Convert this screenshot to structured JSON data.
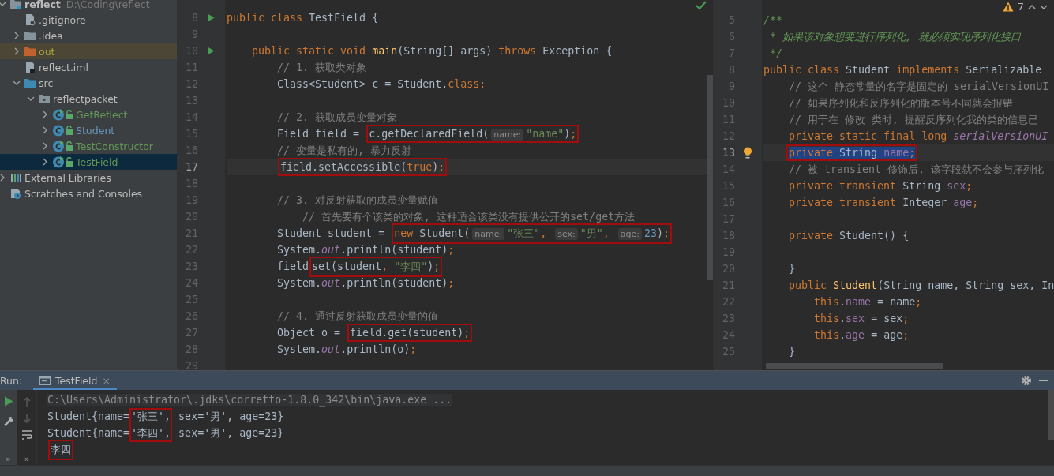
{
  "tree": [
    {
      "kind": "project",
      "name": "reflect",
      "path": "D:\\Coding\\reflect",
      "expanded": true,
      "selected": false,
      "children": [
        {
          "kind": "ignore-file",
          "name": ".gitignore",
          "selected": false
        },
        {
          "kind": "folder",
          "name": ".idea",
          "expanded": false,
          "selected": false
        },
        {
          "kind": "excluded-folder",
          "name": "out",
          "expanded": false,
          "selected": false
        },
        {
          "kind": "module-file",
          "name": "reflect.iml",
          "selected": false
        },
        {
          "kind": "source-folder",
          "name": "src",
          "expanded": true,
          "selected": false,
          "children": [
            {
              "kind": "package",
              "name": "reflectpacket",
              "expanded": true,
              "selected": false,
              "children": [
                {
                  "kind": "runnable-class",
                  "name": "GetReflect",
                  "color": "#629755",
                  "expanded": false,
                  "selected": false
                },
                {
                  "kind": "class",
                  "name": "Student",
                  "color": "#6897bb",
                  "expanded": false,
                  "selected": false
                },
                {
                  "kind": "runnable-class",
                  "name": "TestConstructor",
                  "color": "#629755",
                  "expanded": false,
                  "selected": false
                },
                {
                  "kind": "runnable-class",
                  "name": "TestField",
                  "color": "#629755",
                  "expanded": false,
                  "selected": true
                }
              ]
            }
          ]
        }
      ]
    },
    {
      "kind": "libraries",
      "name": "External Libraries",
      "expanded": false,
      "selected": false
    },
    {
      "kind": "scratches",
      "name": "Scratches and Consoles",
      "selected": false
    }
  ],
  "editors": [
    {
      "inspection": {
        "kind": "ok"
      },
      "lines": [
        {
          "num": "8",
          "current": false,
          "gutter": {
            "kind": "run"
          },
          "segments": [
            {
              "kind": "code",
              "tokens": [
                {
                  "text": "public class ",
                  "kind": "kw"
                },
                {
                  "text": "TestField {",
                  "kind": "plain"
                }
              ]
            }
          ]
        },
        {
          "num": "9",
          "current": false
        },
        {
          "num": "10",
          "current": false,
          "gutter": {
            "kind": "run"
          },
          "segments": [
            {
              "kind": "code",
              "tokens": [
                {
                  "text": "    public static void ",
                  "kind": "kw"
                },
                {
                  "text": "main",
                  "kind": "method"
                },
                {
                  "text": "(String[] args) ",
                  "kind": "plain"
                },
                {
                  "text": "throws ",
                  "kind": "kw"
                },
                {
                  "text": "Exception {",
                  "kind": "plain"
                }
              ]
            }
          ]
        },
        {
          "num": "11",
          "current": false,
          "segments": [
            {
              "kind": "code",
              "tokens": [
                {
                  "text": "        // 1. 获取类对象",
                  "kind": "comment"
                }
              ]
            }
          ]
        },
        {
          "num": "12",
          "current": false,
          "segments": [
            {
              "kind": "code",
              "tokens": [
                {
                  "text": "        Class<Student> c = Student.",
                  "kind": "plain"
                },
                {
                  "text": "class;",
                  "kind": "kw"
                }
              ]
            }
          ]
        },
        {
          "num": "13",
          "current": false
        },
        {
          "num": "14",
          "current": false,
          "segments": [
            {
              "kind": "code",
              "tokens": [
                {
                  "text": "        // 2. 获取成员变量对象",
                  "kind": "comment"
                }
              ]
            }
          ]
        },
        {
          "num": "15",
          "current": false,
          "segments": [
            {
              "kind": "code",
              "tokens": [
                {
                  "text": "        Field field = ",
                  "kind": "plain"
                }
              ]
            },
            {
              "kind": "box",
              "tokens": [
                {
                  "text": "c.getDeclaredField(",
                  "kind": "plain"
                },
                {
                  "text": "name:",
                  "kind": "hint"
                },
                {
                  "text": "\"name\"",
                  "kind": "str"
                },
                {
                  "text": ")",
                  "kind": "plain"
                },
                {
                  "text": ";",
                  "kind": "kw"
                }
              ]
            }
          ]
        },
        {
          "num": "16",
          "current": false,
          "segments": [
            {
              "kind": "code",
              "tokens": [
                {
                  "text": "        // 变量是私有的, 暴力反射",
                  "kind": "comment"
                }
              ]
            }
          ]
        },
        {
          "num": "17",
          "current": true,
          "segments": [
            {
              "kind": "box",
              "tokens": [
                {
                  "text": "        field.setAccessible(",
                  "kind": "plain"
                },
                {
                  "text": "true",
                  "kind": "kw"
                },
                {
                  "text": ")",
                  "kind": "plain"
                },
                {
                  "text": ";",
                  "kind": "kw"
                }
              ]
            }
          ]
        },
        {
          "num": "18",
          "current": false
        },
        {
          "num": "19",
          "current": false,
          "segments": [
            {
              "kind": "code",
              "tokens": [
                {
                  "text": "        // 3. 对反射获取的成员变量赋值",
                  "kind": "comment"
                }
              ]
            }
          ]
        },
        {
          "num": "20",
          "current": false,
          "segments": [
            {
              "kind": "code",
              "tokens": [
                {
                  "text": "            // 首先要有个该类的对象, 这种适合该类没有提供公开的set/get方法",
                  "kind": "comment"
                }
              ]
            }
          ]
        },
        {
          "num": "21",
          "current": false,
          "segments": [
            {
              "kind": "code",
              "tokens": [
                {
                  "text": "        Student student = ",
                  "kind": "plain"
                }
              ]
            },
            {
              "kind": "box",
              "tokens": [
                {
                  "text": "new ",
                  "kind": "kw"
                },
                {
                  "text": "Student(",
                  "kind": "plain"
                },
                {
                  "text": "name:",
                  "kind": "hint"
                },
                {
                  "text": "\"张三\"",
                  "kind": "str"
                },
                {
                  "text": ", ",
                  "kind": "kw"
                },
                {
                  "text": "sex:",
                  "kind": "hint"
                },
                {
                  "text": "\"男\"",
                  "kind": "str"
                },
                {
                  "text": ", ",
                  "kind": "kw"
                },
                {
                  "text": "age:",
                  "kind": "hint"
                },
                {
                  "text": "23",
                  "kind": "num"
                },
                {
                  "text": ")",
                  "kind": "plain"
                },
                {
                  "text": ";",
                  "kind": "kw"
                }
              ]
            }
          ]
        },
        {
          "num": "22",
          "current": false,
          "segments": [
            {
              "kind": "code",
              "tokens": [
                {
                  "text": "        System.",
                  "kind": "plain"
                },
                {
                  "text": "out",
                  "kind": "static"
                },
                {
                  "text": ".println(student)",
                  "kind": "plain"
                },
                {
                  "text": ";",
                  "kind": "kw"
                }
              ]
            }
          ]
        },
        {
          "num": "23",
          "current": false,
          "segments": [
            {
              "kind": "code",
              "tokens": [
                {
                  "text": "        field",
                  "kind": "plain"
                }
              ]
            },
            {
              "kind": "box",
              "tokens": [
                {
                  "text": "set(student",
                  "kind": "plain"
                },
                {
                  "text": ", ",
                  "kind": "kw"
                },
                {
                  "text": "\"李四\"",
                  "kind": "str"
                },
                {
                  "text": ")",
                  "kind": "plain"
                },
                {
                  "text": ";",
                  "kind": "kw"
                }
              ]
            }
          ]
        },
        {
          "num": "24",
          "current": false,
          "segments": [
            {
              "kind": "code",
              "tokens": [
                {
                  "text": "        System.",
                  "kind": "plain"
                },
                {
                  "text": "out",
                  "kind": "static"
                },
                {
                  "text": ".println(student)",
                  "kind": "plain"
                },
                {
                  "text": ";",
                  "kind": "kw"
                }
              ]
            }
          ]
        },
        {
          "num": "25",
          "current": false
        },
        {
          "num": "26",
          "current": false,
          "segments": [
            {
              "kind": "code",
              "tokens": [
                {
                  "text": "        // 4. 通过反射获取成员变量的值",
                  "kind": "comment"
                }
              ]
            }
          ]
        },
        {
          "num": "27",
          "current": false,
          "segments": [
            {
              "kind": "code",
              "tokens": [
                {
                  "text": "        Object o = ",
                  "kind": "plain"
                }
              ]
            },
            {
              "kind": "box",
              "tokens": [
                {
                  "text": "field.get(student)",
                  "kind": "plain"
                },
                {
                  "text": ";",
                  "kind": "kw"
                }
              ]
            }
          ]
        },
        {
          "num": "28",
          "current": false,
          "segments": [
            {
              "kind": "code",
              "tokens": [
                {
                  "text": "        System.",
                  "kind": "plain"
                },
                {
                  "text": "out",
                  "kind": "static"
                },
                {
                  "text": ".println(o)",
                  "kind": "plain"
                },
                {
                  "text": ";",
                  "kind": "kw"
                }
              ]
            }
          ]
        },
        {
          "num": "29",
          "current": false
        }
      ]
    },
    {
      "inspection": {
        "kind": "warnings",
        "count": "7"
      },
      "lines": [
        {
          "num": "5",
          "current": false,
          "segments": [
            {
              "kind": "code",
              "tokens": [
                {
                  "text": "/**",
                  "kind": "doc"
                }
              ]
            }
          ]
        },
        {
          "num": "6",
          "current": false,
          "segments": [
            {
              "kind": "code",
              "tokens": [
                {
                  "text": " * 如果该对象想要进行序列化, 就必须实现序列化接口",
                  "kind": "doc"
                }
              ]
            }
          ]
        },
        {
          "num": "7",
          "current": false,
          "segments": [
            {
              "kind": "code",
              "tokens": [
                {
                  "text": " */",
                  "kind": "doc"
                }
              ]
            }
          ]
        },
        {
          "num": "8",
          "current": false,
          "segments": [
            {
              "kind": "code",
              "tokens": [
                {
                  "text": "public class ",
                  "kind": "kw"
                },
                {
                  "text": "Student ",
                  "kind": "plain"
                },
                {
                  "text": "implements ",
                  "kind": "kw"
                },
                {
                  "text": "Serializable",
                  "kind": "plain"
                }
              ]
            }
          ]
        },
        {
          "num": "9",
          "current": false,
          "segments": [
            {
              "kind": "code",
              "tokens": [
                {
                  "text": "    // 这个 静态常量的名字是固定的 serialVersionUI",
                  "kind": "comment"
                }
              ]
            }
          ]
        },
        {
          "num": "10",
          "current": false,
          "segments": [
            {
              "kind": "code",
              "tokens": [
                {
                  "text": "    // 如果序列化和反序列化的版本号不同就会报错",
                  "kind": "comment"
                }
              ]
            }
          ]
        },
        {
          "num": "11",
          "current": false,
          "segments": [
            {
              "kind": "code",
              "tokens": [
                {
                  "text": "    // 用于在 修改 类时, 提醒反序列化我的类的信息已",
                  "kind": "comment"
                }
              ]
            }
          ]
        },
        {
          "num": "12",
          "current": false,
          "segments": [
            {
              "kind": "code",
              "tokens": [
                {
                  "text": "    private static final long ",
                  "kind": "kw"
                },
                {
                  "text": "serialVersionUI",
                  "kind": "static"
                }
              ]
            }
          ]
        },
        {
          "num": "13",
          "current": true,
          "gutter": {
            "kind": "bulb"
          },
          "segments": [
            {
              "kind": "selected-box",
              "tokens": [
                {
                  "text": "    private ",
                  "kind": "kw"
                },
                {
                  "text": "String ",
                  "kind": "plain"
                },
                {
                  "text": "name",
                  "kind": "field"
                },
                {
                  "text": ";",
                  "kind": "kw"
                }
              ]
            }
          ]
        },
        {
          "num": "14",
          "current": false,
          "segments": [
            {
              "kind": "code",
              "tokens": [
                {
                  "text": "    // 被 transient 修饰后, 该字段就不会参与序列化",
                  "kind": "comment"
                }
              ]
            }
          ]
        },
        {
          "num": "15",
          "current": false,
          "segments": [
            {
              "kind": "code",
              "tokens": [
                {
                  "text": "    private transient ",
                  "kind": "kw"
                },
                {
                  "text": "String ",
                  "kind": "plain"
                },
                {
                  "text": "sex",
                  "kind": "field"
                },
                {
                  "text": ";",
                  "kind": "kw"
                }
              ]
            }
          ]
        },
        {
          "num": "16",
          "current": false,
          "segments": [
            {
              "kind": "code",
              "tokens": [
                {
                  "text": "    private transient ",
                  "kind": "kw"
                },
                {
                  "text": "Integer ",
                  "kind": "plain"
                },
                {
                  "text": "age",
                  "kind": "field"
                },
                {
                  "text": ";",
                  "kind": "kw"
                }
              ]
            }
          ]
        },
        {
          "num": "17",
          "current": false
        },
        {
          "num": "18",
          "current": false,
          "segments": [
            {
              "kind": "code",
              "tokens": [
                {
                  "text": "    private ",
                  "kind": "kw"
                },
                {
                  "text": "Student() {",
                  "kind": "plain"
                }
              ]
            }
          ]
        },
        {
          "num": "19",
          "current": false
        },
        {
          "num": "20",
          "current": false,
          "segments": [
            {
              "kind": "code",
              "tokens": [
                {
                  "text": "    }",
                  "kind": "plain"
                }
              ]
            }
          ]
        },
        {
          "num": "21",
          "current": false,
          "segments": [
            {
              "kind": "code",
              "tokens": [
                {
                  "text": "    public ",
                  "kind": "kw"
                },
                {
                  "text": "Student",
                  "kind": "method"
                },
                {
                  "text": "(String name, String sex, In",
                  "kind": "plain"
                }
              ]
            }
          ]
        },
        {
          "num": "22",
          "current": false,
          "segments": [
            {
              "kind": "code",
              "tokens": [
                {
                  "text": "        this",
                  "kind": "kw"
                },
                {
                  "text": ".",
                  "kind": "plain"
                },
                {
                  "text": "name",
                  "kind": "field"
                },
                {
                  "text": " = name",
                  "kind": "plain"
                },
                {
                  "text": ";",
                  "kind": "kw"
                }
              ]
            }
          ]
        },
        {
          "num": "23",
          "current": false,
          "segments": [
            {
              "kind": "code",
              "tokens": [
                {
                  "text": "        this",
                  "kind": "kw"
                },
                {
                  "text": ".",
                  "kind": "plain"
                },
                {
                  "text": "sex",
                  "kind": "field"
                },
                {
                  "text": " = sex",
                  "kind": "plain"
                },
                {
                  "text": ";",
                  "kind": "kw"
                }
              ]
            }
          ]
        },
        {
          "num": "24",
          "current": false,
          "segments": [
            {
              "kind": "code",
              "tokens": [
                {
                  "text": "        this",
                  "kind": "kw"
                },
                {
                  "text": ".",
                  "kind": "plain"
                },
                {
                  "text": "age",
                  "kind": "field"
                },
                {
                  "text": " = age",
                  "kind": "plain"
                },
                {
                  "text": ";",
                  "kind": "kw"
                }
              ]
            }
          ]
        },
        {
          "num": "25",
          "current": false,
          "segments": [
            {
              "kind": "code",
              "tokens": [
                {
                  "text": "    }",
                  "kind": "plain"
                }
              ]
            }
          ]
        }
      ]
    }
  ],
  "run": {
    "label": "Run:",
    "tab": {
      "title": "TestField",
      "close": "×",
      "selected": true
    },
    "more_left": "»",
    "more_right": "»",
    "console": [
      [
        {
          "kind": "cmd",
          "text": "C:\\Users\\Administrator\\.jdks\\corretto-1.8.0_342\\bin\\java.exe ..."
        }
      ],
      [
        {
          "kind": "out",
          "text": "Student{name="
        },
        {
          "kind": "box-top",
          "text": "'张三',"
        },
        {
          "kind": "out",
          "text": " sex='男', age=23}"
        }
      ],
      [
        {
          "kind": "out",
          "text": "Student{name="
        },
        {
          "kind": "box-bottom",
          "text": "'李四',"
        },
        {
          "kind": "out",
          "text": " sex='男', age=23}"
        }
      ],
      [
        {
          "kind": "box",
          "text": "李四"
        }
      ]
    ]
  }
}
